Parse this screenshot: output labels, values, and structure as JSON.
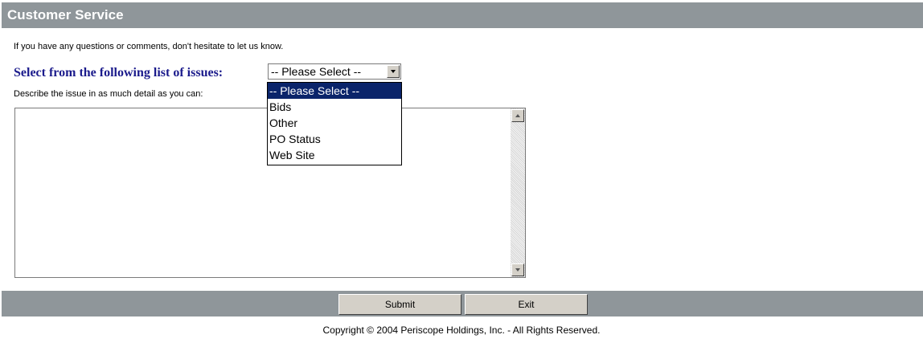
{
  "header": {
    "title": "Customer Service"
  },
  "intro_text": "If you have any questions or comments, don't hesitate to let us know.",
  "issues": {
    "label": "Select from the following list of issues:",
    "selected": "-- Please Select --",
    "options": [
      "-- Please Select --",
      "Bids",
      "Other",
      "PO Status",
      "Web Site"
    ]
  },
  "describe_label": "Describe the issue in as much detail as you can:",
  "details_value": "",
  "buttons": {
    "submit": "Submit",
    "exit": "Exit"
  },
  "copyright": "Copyright © 2004 Periscope Holdings, Inc. - All Rights Reserved.",
  "colors": {
    "header_bg": "#8f969a",
    "label_blue": "#1b1b8c",
    "highlight": "#0a246a"
  }
}
